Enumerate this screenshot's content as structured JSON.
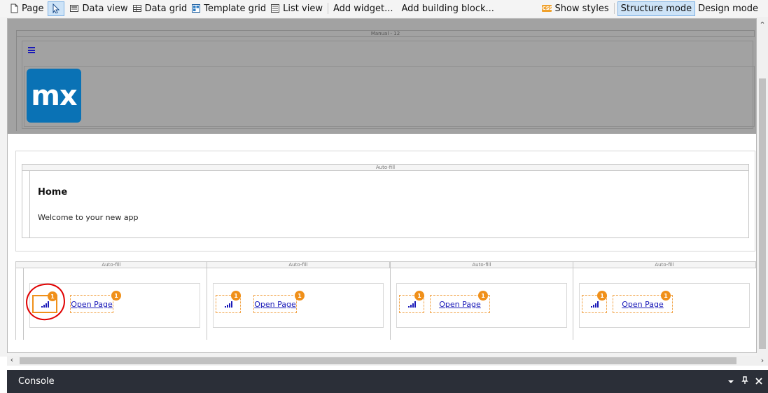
{
  "toolbar": {
    "page_label": "Page",
    "data_view_label": "Data view",
    "data_grid_label": "Data grid",
    "template_grid_label": "Template grid",
    "list_view_label": "List view",
    "add_widget_label": "Add widget...",
    "add_building_block_label": "Add building block...",
    "show_styles_label": "Show styles",
    "css_badge": "CSS",
    "structure_mode_label": "Structure mode",
    "design_mode_label": "Design mode",
    "active_mode": "Structure mode"
  },
  "layout": {
    "manual_bar_label": "Manual - 12",
    "logo_text": "mx",
    "logo_color": "#0a72b5"
  },
  "home": {
    "autofill_label": "Auto-fill",
    "title": "Home",
    "subtitle": "Welcome to your new app"
  },
  "grid": {
    "columns": [
      {
        "autofill_label": "Auto-fill",
        "link_label": "Open Page",
        "badge_icon": "1",
        "badge_link": "1",
        "selected": true
      },
      {
        "autofill_label": "Auto-fill",
        "link_label": "Open Page",
        "badge_icon": "1",
        "badge_link": "1",
        "selected": false
      },
      {
        "autofill_label": "Auto-fill",
        "link_label": "Open Page",
        "badge_icon": "1",
        "badge_link": "1",
        "selected": false
      },
      {
        "autofill_label": "Auto-fill",
        "link_label": "Open Page",
        "badge_icon": "1",
        "badge_link": "1",
        "selected": false
      }
    ]
  },
  "console": {
    "title": "Console"
  },
  "colors": {
    "accent_orange": "#f0901a",
    "link_blue": "#1a1ab8",
    "annotation_red": "#e00000"
  }
}
